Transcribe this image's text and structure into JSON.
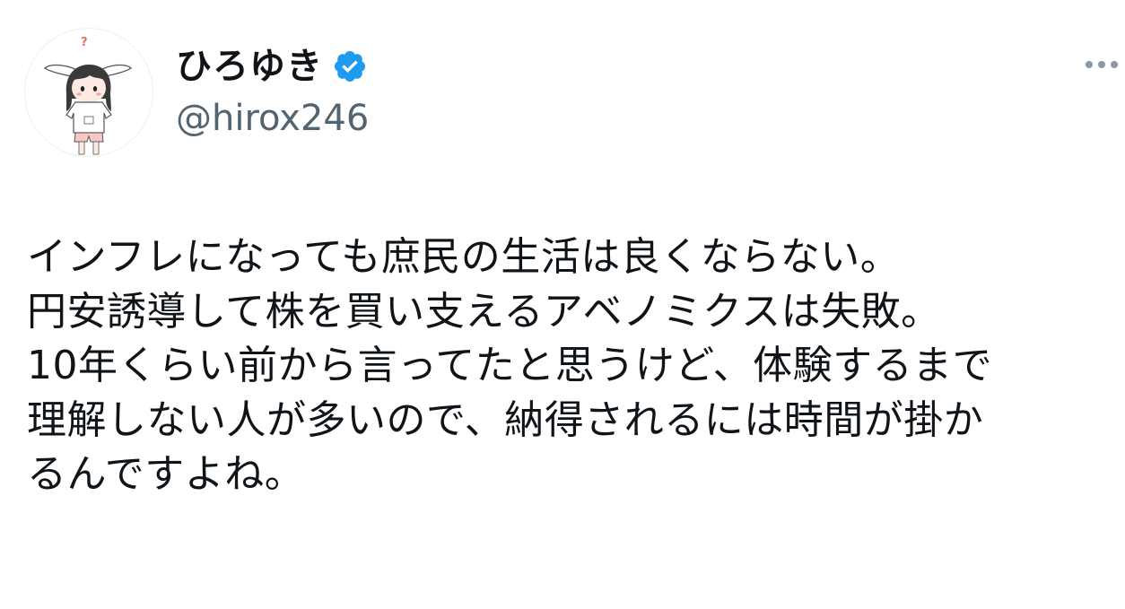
{
  "author": {
    "display_name": "ひろゆき",
    "handle": "@hirox246",
    "verified": true,
    "avatar_icon": "avatar-bunny-ear-character",
    "verified_icon": "verified-badge-icon",
    "verified_color": "#1d9bf0"
  },
  "actions": {
    "more_icon": "more-options-icon",
    "more_color": "#8b98a5"
  },
  "tweet": {
    "lines": [
      "インフレになっても庶民の生活は良くならない。",
      "円安誘導して株を買い支えるアベノミクスは失敗。",
      "10年くらい前から言ってたと思うけど、体験するまで",
      "理解しない人が多いので、納得されるには時間が掛か",
      "るんですよね。"
    ]
  }
}
